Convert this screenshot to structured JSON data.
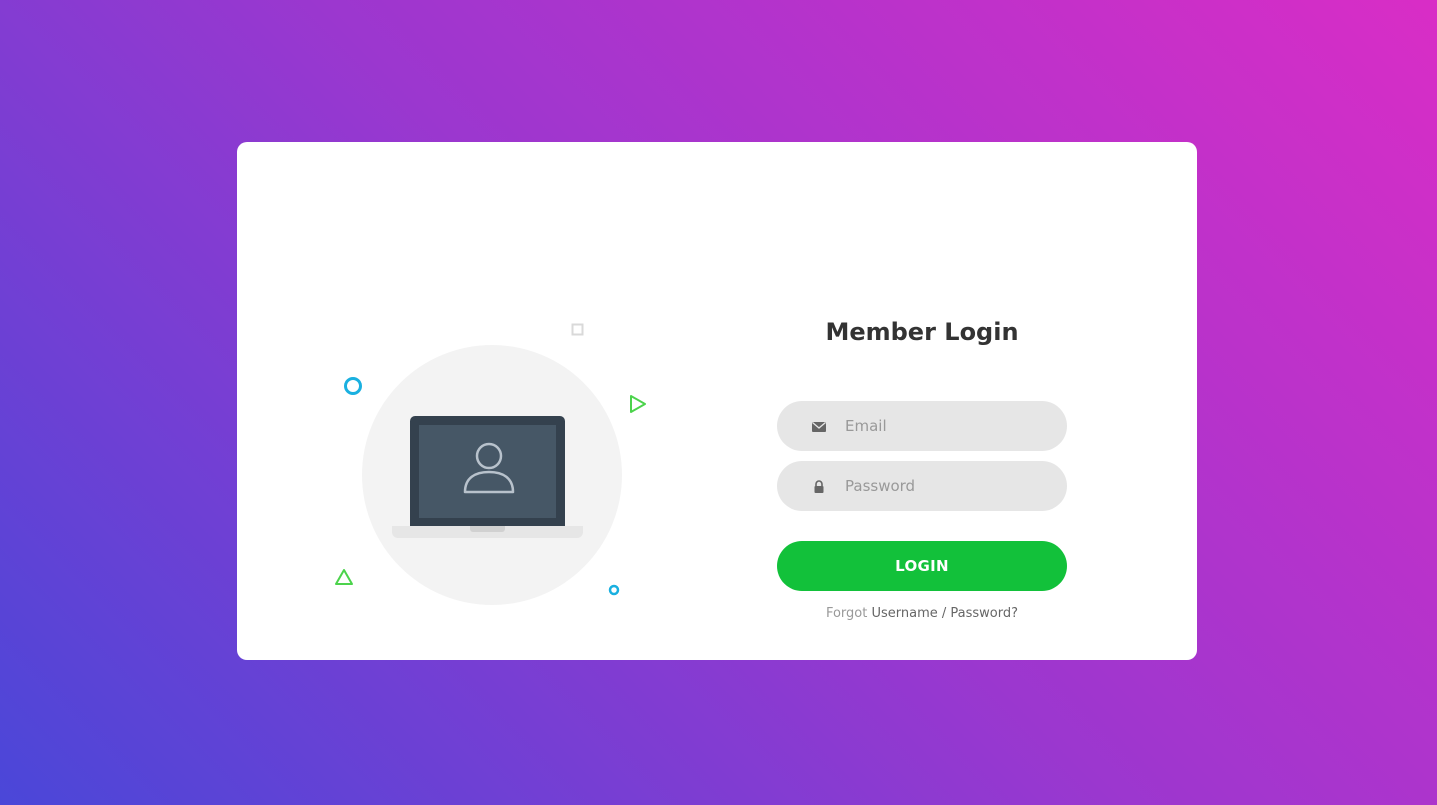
{
  "login_form": {
    "title": "Member Login",
    "email_placeholder": "Email",
    "password_placeholder": "Password",
    "login_button_label": "LOGIN",
    "forgot_prefix": "Forgot",
    "forgot_link_label": "Username / Password?"
  },
  "icons": {
    "email_field": "envelope-icon",
    "password_field": "lock-icon",
    "illustration_user": "user-icon"
  },
  "colors": {
    "background_gradient_start": "#4a47d8",
    "background_gradient_end": "#d92dc6",
    "card": "#ffffff",
    "input_background": "#e6e6e6",
    "login_button": "#12c13a",
    "title_text": "#333333",
    "accent_cyan": "#1ab0e0",
    "accent_green": "#4cd34c"
  }
}
